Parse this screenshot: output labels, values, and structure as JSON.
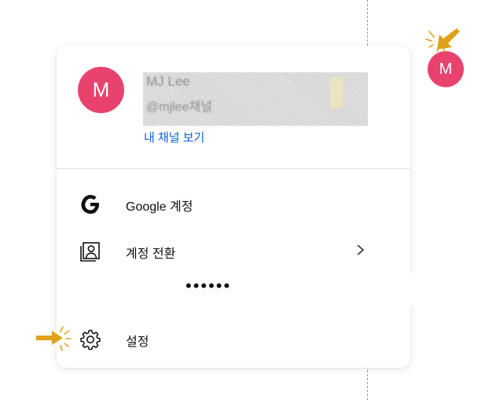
{
  "account": {
    "avatar_letter": "M",
    "avatar_color": "#e8436f",
    "name": "MJ Lee",
    "handle": "@mjlee채널",
    "view_channel_label": "내 채널 보기"
  },
  "menu": {
    "items": [
      {
        "label": "Google 계정",
        "icon": "google-g-icon"
      },
      {
        "label": "계정 전환",
        "icon": "switch-account-icon",
        "has_submenu": true
      },
      {
        "label": "설정",
        "icon": "gear-icon"
      }
    ],
    "omitted_marker": "••••••"
  },
  "annotations": {
    "pointer_color": "#e0a11b",
    "pointer_icon": "arrow-pointer-icon"
  },
  "colors": {
    "link": "#0b62d6"
  }
}
